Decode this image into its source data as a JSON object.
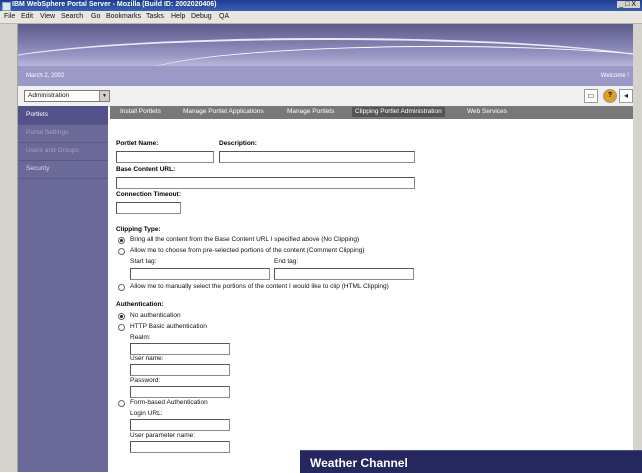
{
  "window": {
    "title": "IBM WebSphere Portal Server - Mozilla (Build ID: 2002020406)",
    "controls": "_□X"
  },
  "menubar": [
    "File",
    "Edit",
    "View",
    "Search",
    "Go",
    "Bookmarks",
    "Tasks",
    "Help",
    "Debug",
    "QA"
  ],
  "header": {
    "date": "March 2, 2002",
    "welcome": "Welcome !"
  },
  "toolbar": {
    "select_value": "Administration",
    "icons": [
      "print-icon",
      "help-icon",
      "back-icon"
    ]
  },
  "sidebar": {
    "items": [
      {
        "label": "Portlets"
      },
      {
        "label": "Portal Settings"
      },
      {
        "label": "Users and Groups"
      },
      {
        "label": "Security"
      }
    ]
  },
  "tabs": [
    {
      "label": "Install Portlets"
    },
    {
      "label": "Manage Portlet Applications"
    },
    {
      "label": "Manage Portlets"
    },
    {
      "label": "Clipping Portlet Administration"
    },
    {
      "label": "Web Services"
    }
  ],
  "form": {
    "portlet_name_label": "Portlet Name:",
    "description_label": "Description:",
    "base_url_label": "Base Content URL:",
    "timeout_label": "Connection Timeout:",
    "clipping_type_label": "Clipping Type:",
    "clipping_options": [
      "Bring all the content from the Base Content URL I specified above (No Clipping)",
      "Allow me to choose from pre-selected portions of the content (Comment Clipping)",
      "Allow me to manually select the portions of the content I would like to clip (HTML Clipping)"
    ],
    "start_tag_label": "Start tag:",
    "end_tag_label": "End tag:",
    "authentication_label": "Authentication:",
    "auth_options": [
      "No authentication",
      "HTTP Basic authentication",
      "Form-based Authentication"
    ],
    "realm_label": "Realm:",
    "username_label": "User name:",
    "password_label": "Password:",
    "login_url_label": "Login URL:",
    "user_param_label": "User parameter name:"
  },
  "overlay": {
    "title": "Weather Channel"
  }
}
